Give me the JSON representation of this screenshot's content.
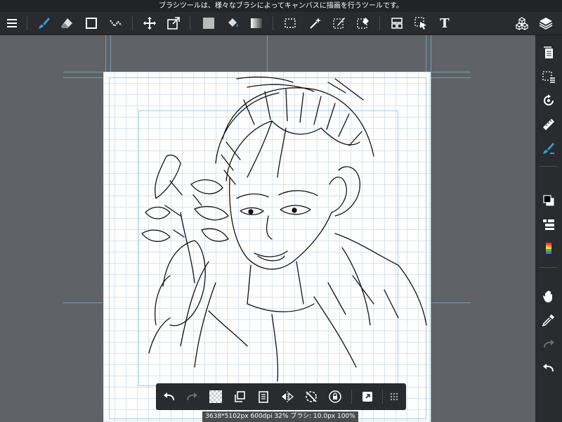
{
  "tip": "ブラシツールは、様々なブラシによってキャンバスに描画を行うツールです。",
  "status": "3638*5102px 600dpi 32% ブラシ: 10.0px 100%",
  "colors": {
    "accent": "#2aa0e0",
    "toolbar_bg": "#2a2b2e",
    "workspace_bg": "#5f6266",
    "guide": "#7fb6c9"
  },
  "toolbar": {
    "items": [
      "menu-icon",
      "brush-icon",
      "eraser-icon",
      "shape-icon",
      "dot-icon",
      "move-icon",
      "transform-icon",
      "fill-color-icon",
      "bucket-icon",
      "gradient-icon",
      "select-rect-icon",
      "magic-wand-icon",
      "select-pen-icon",
      "select-eraser-icon",
      "frame-icon",
      "select-operation-icon",
      "text-icon",
      "material-icon",
      "layer-icon"
    ],
    "text_tool_label": "T"
  },
  "right_toolbar": {
    "items": [
      "page-icon",
      "select-layer-icon",
      "rotate-view-icon",
      "ruler-icon",
      "brush-panel-icon",
      "color-swatch-icon",
      "layer-list-icon",
      "palette-icon",
      "hand-icon",
      "eyedropper-icon",
      "redo-icon",
      "undo-icon"
    ]
  },
  "bottom_toolbar": {
    "items": [
      "undo-icon",
      "redo-icon",
      "transparent-icon",
      "copy-icon",
      "paste-icon",
      "flip-icon",
      "rotate-reset-icon",
      "lock-icon",
      "snap-icon",
      "more-icon"
    ]
  }
}
